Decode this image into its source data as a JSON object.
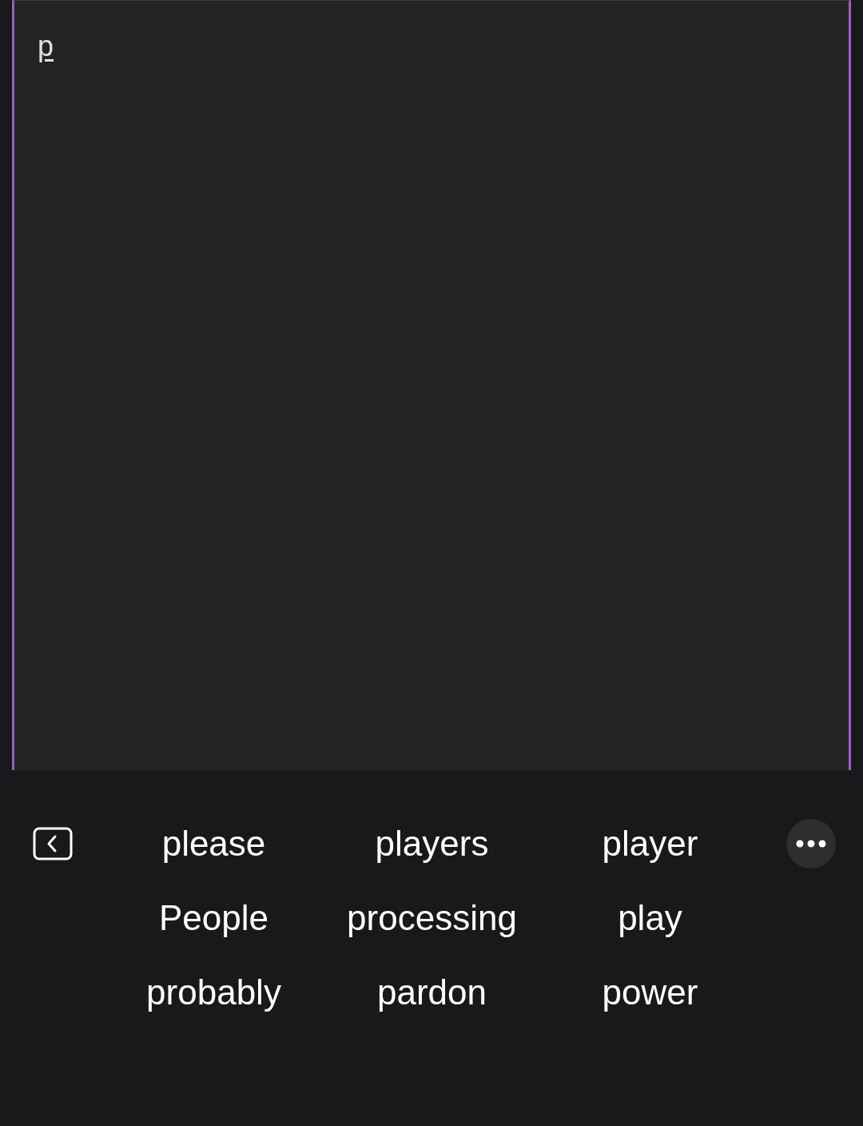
{
  "editor": {
    "text": "p"
  },
  "suggestions": [
    {
      "label": "please"
    },
    {
      "label": "players"
    },
    {
      "label": "player"
    },
    {
      "label": "People"
    },
    {
      "label": "processing"
    },
    {
      "label": "play"
    },
    {
      "label": "probably"
    },
    {
      "label": "pardon"
    },
    {
      "label": "power"
    }
  ]
}
